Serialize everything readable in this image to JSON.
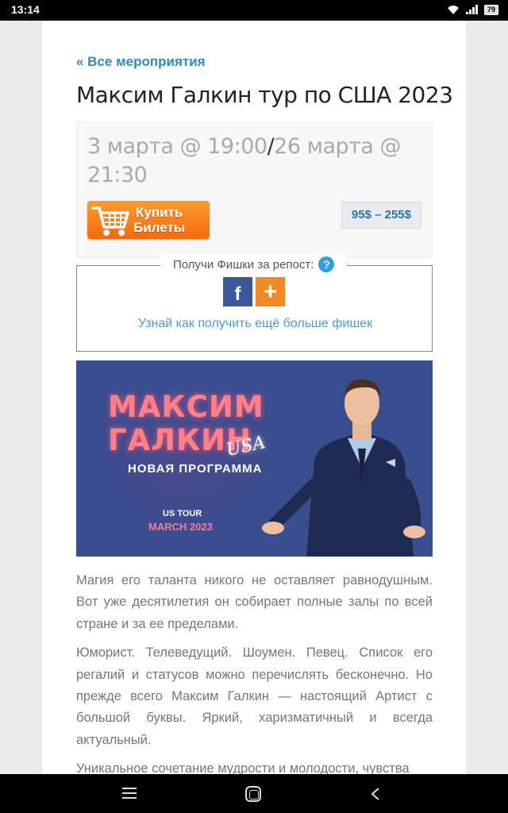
{
  "status_bar": {
    "time": "13:14",
    "battery": "79"
  },
  "nav": {
    "back_link": "« Все мероприятия"
  },
  "event": {
    "title": "Максим Галкин тур по США 2023",
    "start": "3 марта @ 19:00",
    "separator": "/",
    "end": "26 марта @ 21:30",
    "buy_button": {
      "line1": "Купить",
      "line2": "Билеты"
    },
    "price": "95$ – 255$"
  },
  "share": {
    "label": "Получи Фишки за репост:",
    "help": "?",
    "facebook": "f",
    "more": "+",
    "more_link": "Узнай как получить ещё больше фишек"
  },
  "banner": {
    "name_line1": "МАКСИМ",
    "name_line2": "ГАЛКИН",
    "usa": "USA",
    "program": "НОВАЯ ПРОГРАММА",
    "tour": "US TOUR",
    "month": "MARCH 2023"
  },
  "article": {
    "paragraphs": [
      "Магия его таланта никого не оставляет равнодушным. Вот уже десятилетия он собирает полные залы по всей стране и за ее пределами.",
      "Юморист. Телеведущий. Шоумен. Певец. Список его регалий и статусов можно перечислять бесконечно. Но прежде всего Максим Галкин — настоящий Артист с большой буквы. Яркий, харизматичный и всегда актуальный.",
      "Уникальное сочетание мудрости и молодости, чувства"
    ]
  },
  "colors": {
    "accent": "#2e8bc0",
    "buy_orange": "#f26b0f",
    "facebook": "#3b5998",
    "banner_bg": "#3a4d8f"
  }
}
